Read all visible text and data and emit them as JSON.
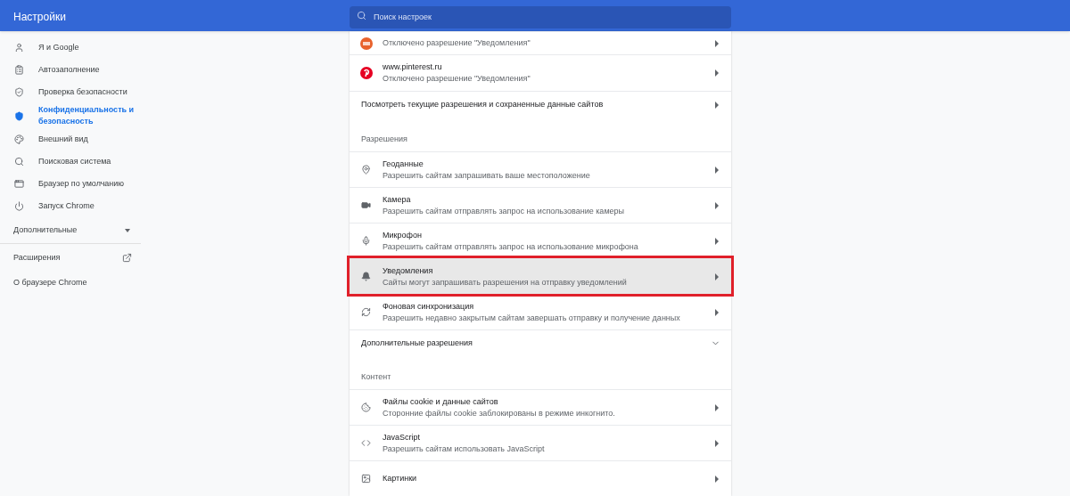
{
  "header": {
    "title": "Настройки",
    "search": {
      "placeholder": "Поиск настроек"
    }
  },
  "sidebar": {
    "items": [
      {
        "label": "Я и Google",
        "selected": false
      },
      {
        "label": "Автозаполнение",
        "selected": false
      },
      {
        "label": "Проверка безопасности",
        "selected": false
      },
      {
        "label": "Конфиденциальность и безопасность",
        "selected": true
      },
      {
        "label": "Внешний вид",
        "selected": false
      },
      {
        "label": "Поисковая система",
        "selected": false
      },
      {
        "label": "Браузер по умолчанию",
        "selected": false
      },
      {
        "label": "Запуск Chrome",
        "selected": false
      }
    ],
    "advanced": {
      "label": "Дополнительные",
      "expanded": false
    },
    "links": [
      {
        "label": "Расширения",
        "external": true
      },
      {
        "label": "О браузере Chrome",
        "external": false
      }
    ]
  },
  "sites": [
    {
      "subtitle": "Отключено разрешение \"Уведомления\""
    },
    {
      "title": "www.pinterest.ru",
      "subtitle": "Отключено разрешение \"Уведомления\""
    }
  ],
  "site_data_link": "Посмотреть текущие разрешения и сохраненные данные сайтов",
  "permissions": {
    "heading": "Разрешения",
    "rows": [
      {
        "title": "Геоданные",
        "subtitle": "Разрешить сайтам запрашивать ваше местоположение",
        "highlighted": false
      },
      {
        "title": "Камера",
        "subtitle": "Разрешить сайтам отправлять запрос на использование камеры",
        "highlighted": false
      },
      {
        "title": "Микрофон",
        "subtitle": "Разрешить сайтам отправлять запрос на использование микрофона",
        "highlighted": false
      },
      {
        "title": "Уведомления",
        "subtitle": "Сайты могут запрашивать разрешения на отправку уведомлений",
        "highlighted": true
      },
      {
        "title": "Фоновая синхронизация",
        "subtitle": "Разрешить недавно закрытым сайтам завершать отправку и получение данных",
        "highlighted": false
      }
    ],
    "more": {
      "label": "Дополнительные разрешения",
      "expanded": false
    }
  },
  "content": {
    "heading": "Контент",
    "rows": [
      {
        "title": "Файлы cookie и данные сайтов",
        "subtitle": "Сторонние файлы cookie заблокированы в режиме инкогнито."
      },
      {
        "title": "JavaScript",
        "subtitle": "Разрешить сайтам использовать JavaScript"
      },
      {
        "title": "Картинки"
      }
    ]
  }
}
